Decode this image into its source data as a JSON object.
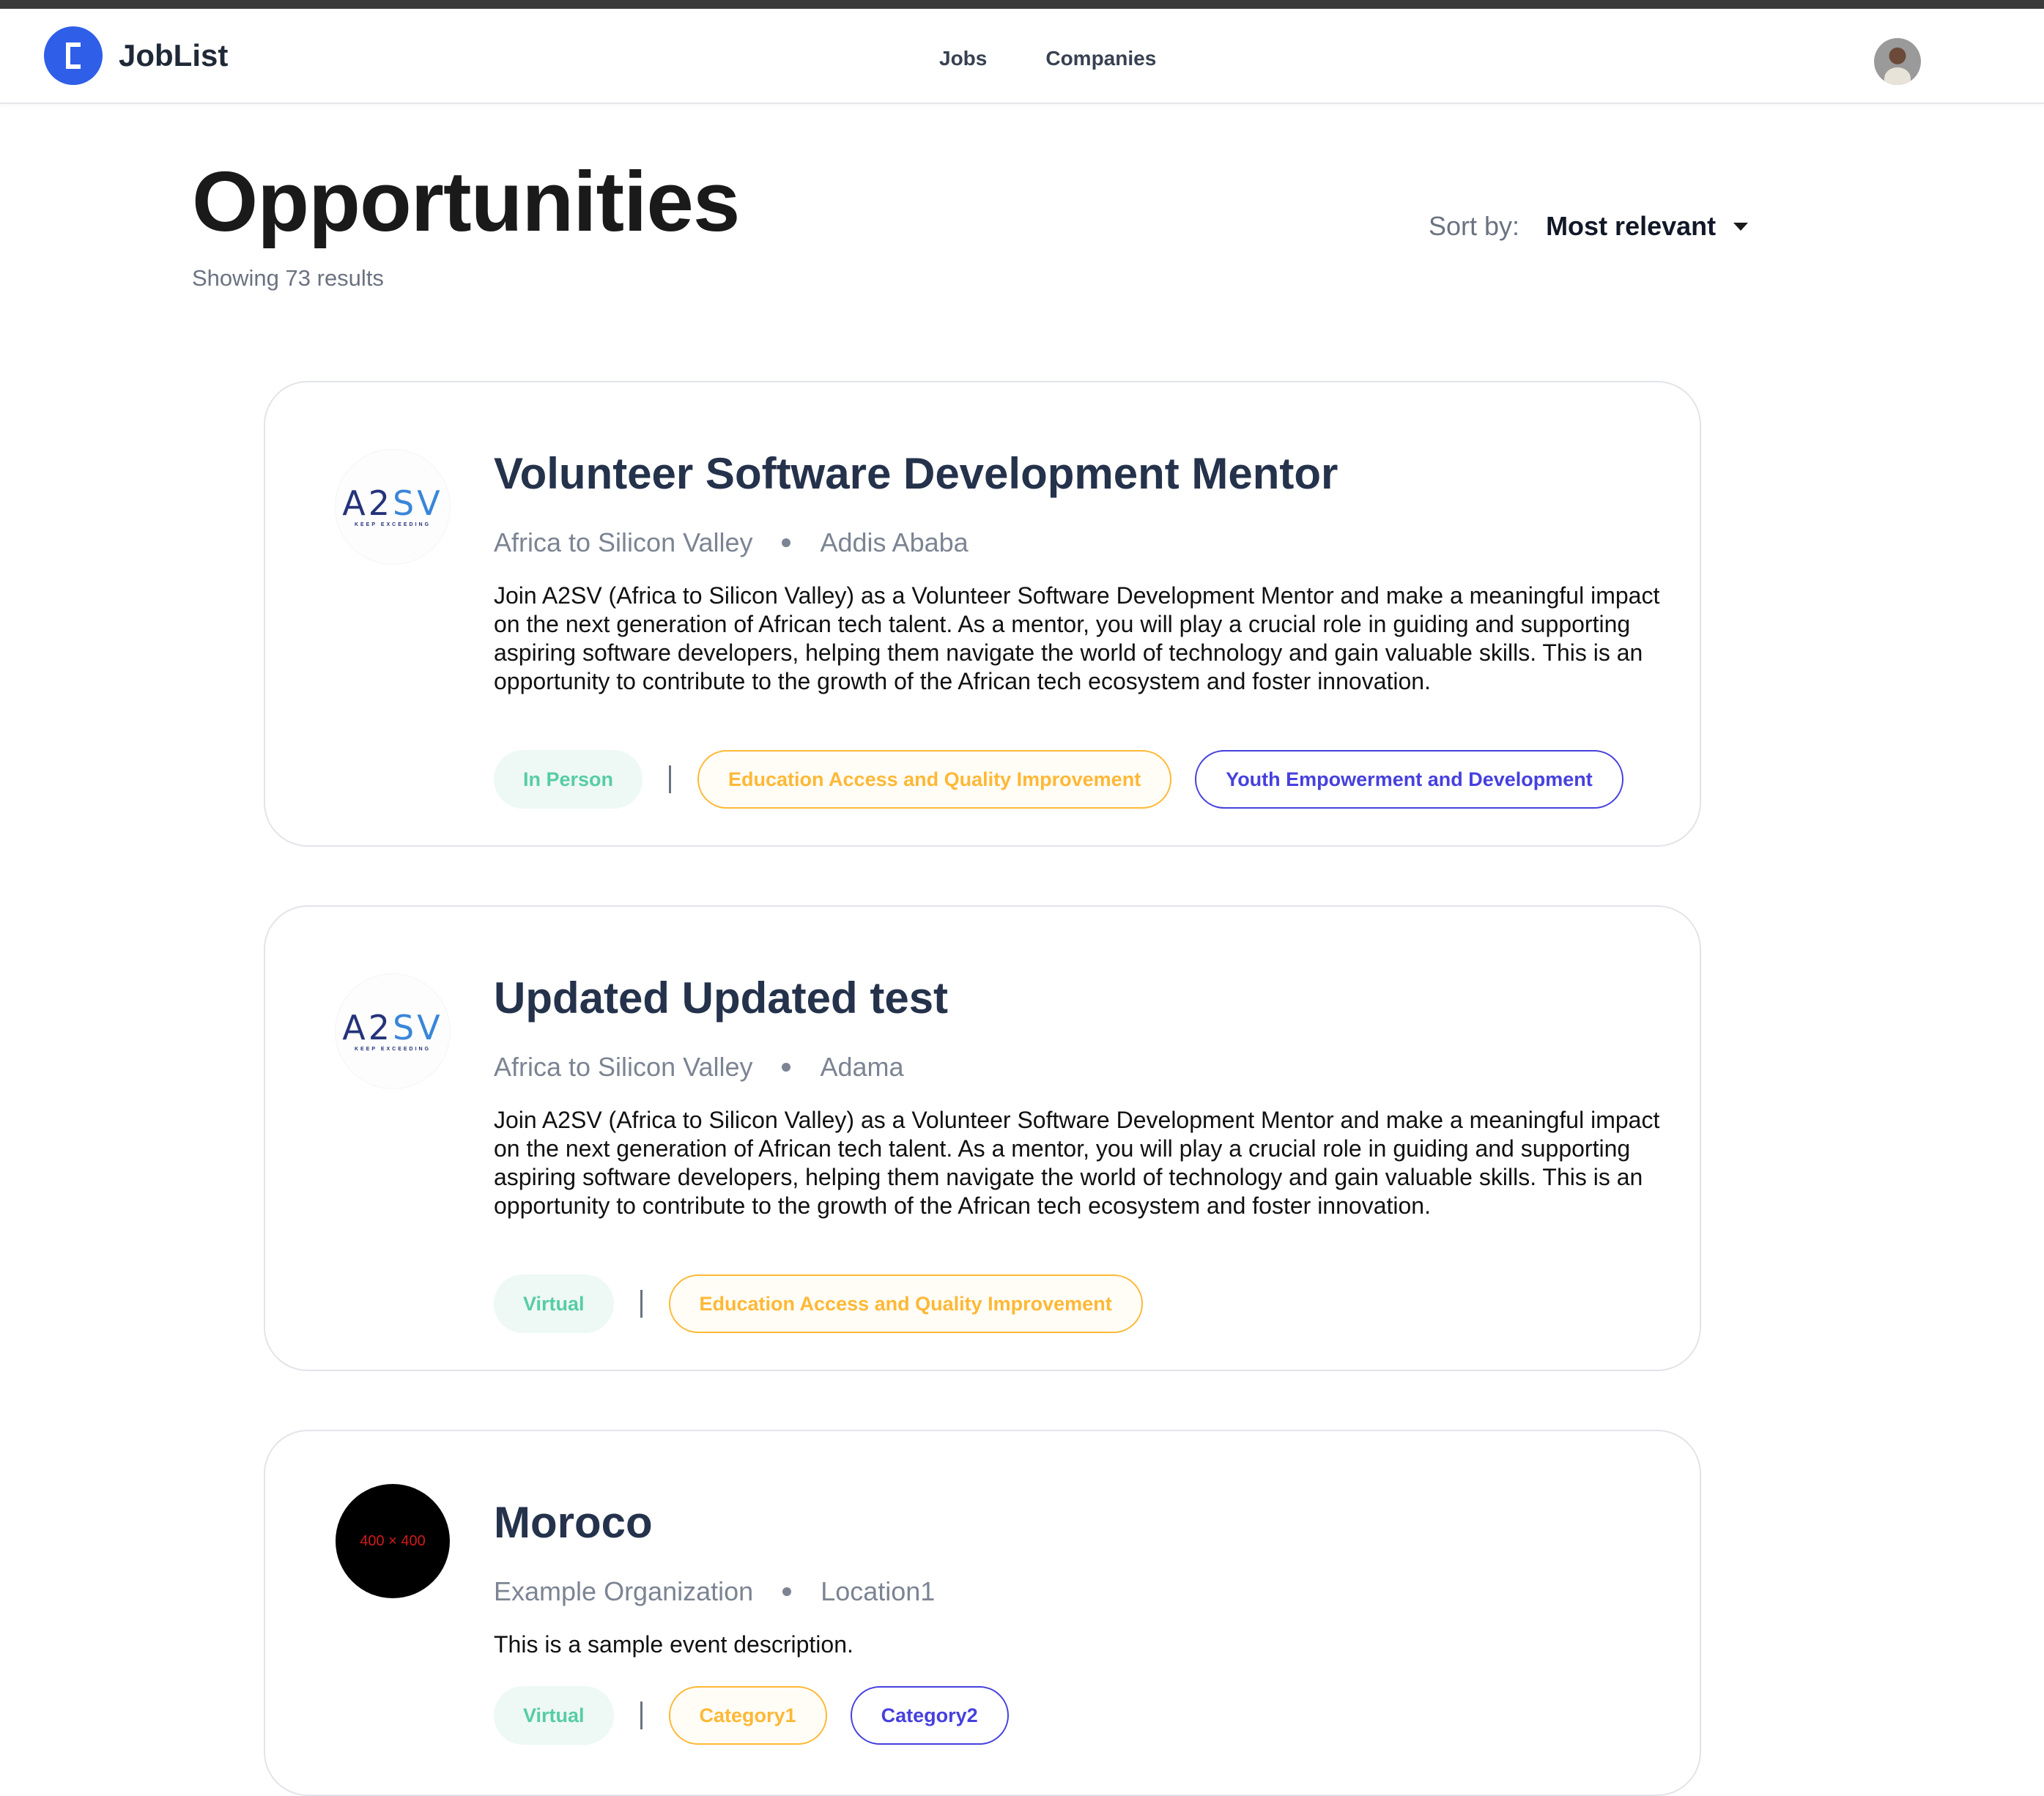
{
  "app": {
    "name": "JobList"
  },
  "nav": {
    "links": [
      "Jobs",
      "Companies"
    ]
  },
  "page": {
    "title": "Opportunities",
    "result_count": "Showing 73 results",
    "sort_label": "Sort by:",
    "sort_value": "Most relevant"
  },
  "cards": [
    {
      "logo": "A2SV",
      "logo_sub": "KEEP EXCEEDING",
      "title": "Volunteer Software Development Mentor",
      "org": "Africa to Silicon Valley",
      "location": "Addis Ababa",
      "description": "Join A2SV (Africa to Silicon Valley) as a Volunteer Software Development Mentor and make a meaningful impact on the next generation of African tech talent. As a mentor, you will play a crucial role in guiding and supporting aspiring software developers, helping them navigate the world of technology and gain valuable skills. This is an opportunity to contribute to the growth of the African tech ecosystem and foster innovation.",
      "mode": "In Person",
      "categories": [
        "Education Access and Quality Improvement",
        "Youth Empowerment and Development"
      ]
    },
    {
      "logo": "A2SV",
      "logo_sub": "KEEP EXCEEDING",
      "title": "Updated Updated test",
      "org": "Africa to Silicon Valley",
      "location": "Adama",
      "description": "Join A2SV (Africa to Silicon Valley) as a Volunteer Software Development Mentor and make a meaningful impact on the next generation of African tech talent. As a mentor, you will play a crucial role in guiding and supporting aspiring software developers, helping them navigate the world of technology and gain valuable skills. This is an opportunity to contribute to the growth of the African tech ecosystem and foster innovation.",
      "mode": "Virtual",
      "categories": [
        "Education Access and Quality Improvement"
      ]
    },
    {
      "logo": "400 × 400",
      "title": "Moroco",
      "org": "Example Organization",
      "location": "Location1",
      "description": "This is a sample event description.",
      "mode": "Virtual",
      "categories": [
        "Category1",
        "Category2"
      ]
    }
  ],
  "colors": {
    "brand": "#2f5ee8",
    "title_text": "#25324b",
    "mode_tag_text": "#56cda4",
    "mode_tag_bg": "#eef8f5",
    "category_yellow": "#ffb836",
    "category_blue": "#4640de"
  },
  "icons": {
    "brand": "joblist-logo-icon",
    "sort": "caret-down-icon",
    "profile": "avatar"
  }
}
